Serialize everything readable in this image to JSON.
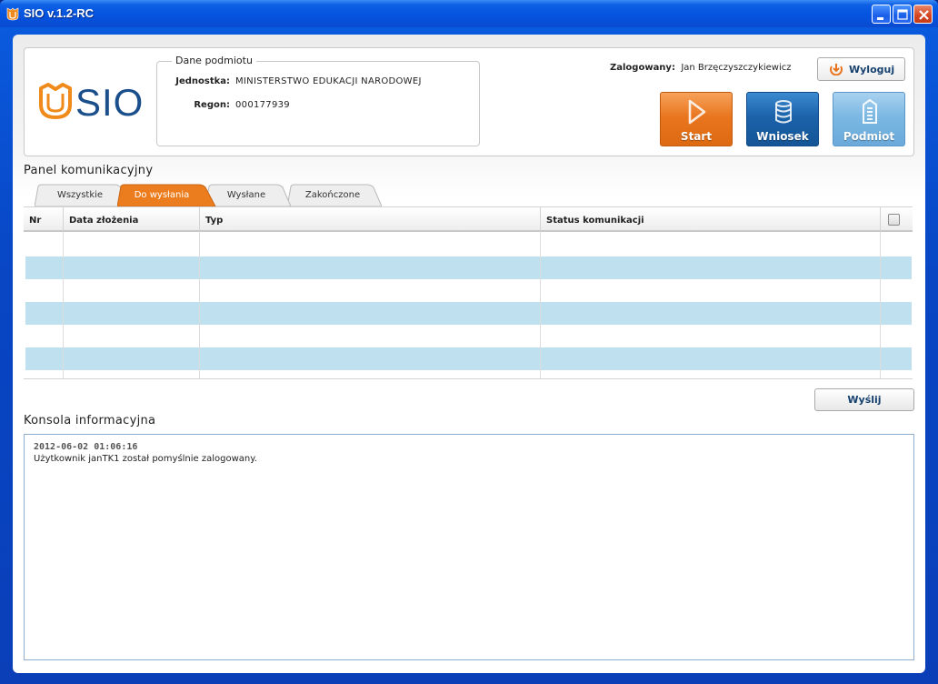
{
  "window": {
    "title": "SIO v.1.2-RC"
  },
  "logo": {
    "text": "SIO"
  },
  "entity": {
    "legend": "Dane podmiotu",
    "unit_label": "Jednostka:",
    "unit_value": "MINISTERSTWO EDUKACJI NARODOWEJ",
    "regon_label": "Regon:",
    "regon_value": "000177939"
  },
  "user": {
    "logged_label": "Zalogowany:",
    "name": "Jan Brzęczyszczykiewicz",
    "logout_label": "Wyloguj"
  },
  "toolbar": {
    "start": "Start",
    "wniosek": "Wniosek",
    "podmiot": "Podmiot"
  },
  "panel": {
    "title": "Panel komunikacyjny",
    "tabs": [
      {
        "label": "Wszystkie",
        "active": false
      },
      {
        "label": "Do wysłania",
        "active": true
      },
      {
        "label": "Wysłane",
        "active": false
      },
      {
        "label": "Zakończone",
        "active": false
      }
    ],
    "columns": [
      "Nr",
      "Data złożenia",
      "Typ",
      "Status komunikacji"
    ],
    "send_label": "Wyślij"
  },
  "console": {
    "title": "Konsola informacyjna",
    "entries": [
      {
        "timestamp": "2012-06-02 01:06:16",
        "message": "Użytkownik janTK1 został pomyślnie zalogowany."
      }
    ]
  },
  "colors": {
    "accent_orange": "#e9761f",
    "accent_blue": "#1b62aa",
    "row_alt": "#bfe0ee",
    "titlebar": "#0554e0"
  }
}
